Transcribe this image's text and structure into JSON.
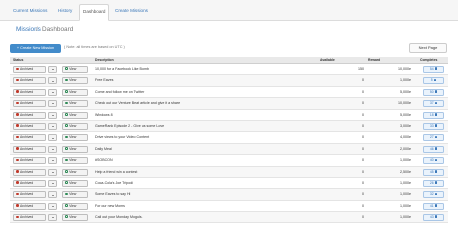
{
  "topnav": {
    "tabs": [
      {
        "label": "Current Missions",
        "active": false
      },
      {
        "label": "History",
        "active": false
      },
      {
        "label": "Dashboard",
        "active": true
      },
      {
        "label": "Create Missions",
        "active": false
      }
    ]
  },
  "breadcrumb": {
    "root": "Missions",
    "separator": "/",
    "current": "Dashboard"
  },
  "toolbar": {
    "create_label": "+ Create New Mission",
    "note": "( Note: all times are based on UTC )",
    "next_label": "Next Page"
  },
  "table": {
    "headers": {
      "status": "Status",
      "description": "Description",
      "available": "Available",
      "reward": "Reward",
      "completes": "Completes"
    },
    "rows": [
      {
        "status": "Archived",
        "view": "View",
        "description": "10,000 for a Facebook Like Bomb",
        "available": "150",
        "reward": "10,000e",
        "completes": "54"
      },
      {
        "status": "Archived",
        "view": "View",
        "description": "Free Eaves",
        "available": "0",
        "reward": "1,000e",
        "completes": "5"
      },
      {
        "status": "Archived",
        "view": "View",
        "description": "Come and follow me on Twitter",
        "available": "0",
        "reward": "5,000e",
        "completes": "50"
      },
      {
        "status": "Archived",
        "view": "View",
        "description": "Check out our Venture Beat article and give it a share",
        "available": "0",
        "reward": "10,000e",
        "completes": "37"
      },
      {
        "status": "Archived",
        "view": "View",
        "description": "Windows 8",
        "available": "0",
        "reward": "5,000e",
        "completes": "18"
      },
      {
        "status": "Archived",
        "view": "View",
        "description": "GameRank Episode 2 - Give us some Love",
        "available": "0",
        "reward": "3,000e",
        "completes": "33"
      },
      {
        "status": "Archived",
        "view": "View",
        "description": "Drive views to your Video Content",
        "available": "0",
        "reward": "4,000e",
        "completes": "27"
      },
      {
        "status": "Archived",
        "view": "View",
        "description": "Daily Meal",
        "available": "0",
        "reward": "2,000e",
        "completes": "46"
      },
      {
        "status": "Archived",
        "view": "View",
        "description": "#SOBCON",
        "available": "0",
        "reward": "1,000e",
        "completes": "40"
      },
      {
        "status": "Archived",
        "view": "View",
        "description": "Help a friend win a contest",
        "available": "0",
        "reward": "2,500e",
        "completes": "45"
      },
      {
        "status": "Archived",
        "view": "View",
        "description": "Coca-Cola's Joe Tripodi",
        "available": "0",
        "reward": "1,000e",
        "completes": "26"
      },
      {
        "status": "Archived",
        "view": "View",
        "description": "Some Eaves to say Hi",
        "available": "0",
        "reward": "1,000e",
        "completes": "32"
      },
      {
        "status": "Archived",
        "view": "View",
        "description": "For our new Moms",
        "available": "0",
        "reward": "1,000e",
        "completes": "41"
      },
      {
        "status": "Archived",
        "view": "View",
        "description": "Call out your Monday Moguls.",
        "available": "0",
        "reward": "1,000e",
        "completes": "43"
      }
    ]
  },
  "colors": {
    "primary": "#428bca",
    "link": "#3a77b8",
    "header_bg": "#e9e9e9",
    "archived_dot": "#c0392b"
  }
}
